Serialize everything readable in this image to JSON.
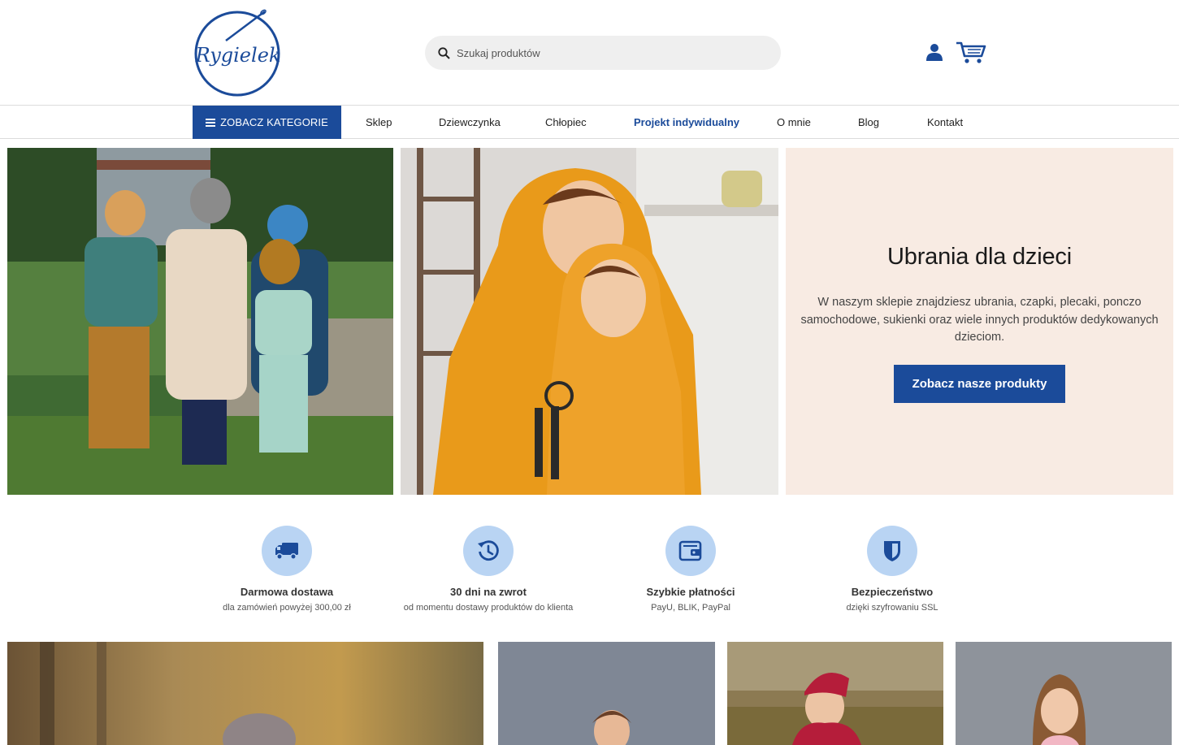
{
  "header": {
    "logo_text": "Rygielek",
    "search_placeholder": "Szukaj produktów"
  },
  "nav": {
    "categories_label": "ZOBACZ KATEGORIE",
    "links": [
      "Sklep",
      "Dziewczynka",
      "Chłopiec",
      "Projekt indywidualny",
      "O mnie",
      "Blog",
      "Kontakt"
    ]
  },
  "hero": {
    "title": "Ubrania dla dzieci",
    "description": "W naszym sklepie znajdziesz ubrania, czapki, plecaki, ponczo samochodowe, sukienki oraz wiele innych produktów dedykowanych dzieciom.",
    "button_label": "Zobacz nasze produkty"
  },
  "features": [
    {
      "title": "Darmowa dostawa",
      "subtitle": "dla zamówień powyżej 300,00 zł",
      "icon": "truck-icon"
    },
    {
      "title": "30 dni na zwrot",
      "subtitle": "od momentu dostawy produktów do klienta",
      "icon": "history-icon"
    },
    {
      "title": "Szybkie płatności",
      "subtitle": "PayU, BLIK, PayPal",
      "icon": "wallet-icon"
    },
    {
      "title": "Bezpieczeństwo",
      "subtitle": "dzięki szyfrowaniu SSL",
      "icon": "shield-icon"
    }
  ],
  "colors": {
    "brand": "#1b4b9a",
    "hero_bg": "#f8ebe3",
    "feature_circle": "#b9d4f3"
  }
}
